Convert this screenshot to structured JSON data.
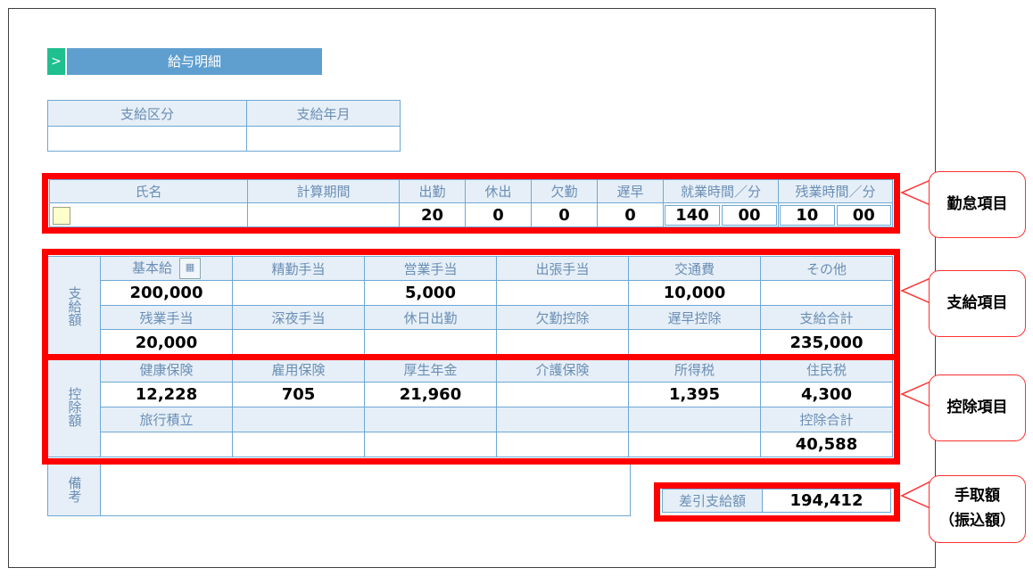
{
  "title": {
    "arrow": ">",
    "label": "給与明細"
  },
  "payment_info": {
    "headers": [
      "支給区分",
      "支給年月"
    ],
    "values": [
      "",
      ""
    ]
  },
  "attendance": {
    "headers": [
      "氏名",
      "計算期間",
      "出勤",
      "休出",
      "欠勤",
      "遅早",
      "就業時間／分",
      "残業時間／分"
    ],
    "values": {
      "name": "",
      "period": "",
      "work_days": "20",
      "holiday_work": "0",
      "absence": "0",
      "late_early": "0",
      "work_hours": "140",
      "work_minutes": "00",
      "overtime_hours": "10",
      "overtime_minutes": "00"
    }
  },
  "payments": {
    "side_label": "支給額",
    "row1_headers": [
      "基本給",
      "精勤手当",
      "営業手当",
      "出張手当",
      "交通費",
      "その他"
    ],
    "row1_values": [
      "200,000",
      "",
      "5,000",
      "",
      "10,000",
      ""
    ],
    "row2_headers": [
      "残業手当",
      "深夜手当",
      "休日出勤",
      "欠勤控除",
      "遅早控除",
      "支給合計"
    ],
    "row2_values": [
      "20,000",
      "",
      "",
      "",
      "",
      "235,000"
    ]
  },
  "deductions": {
    "side_label": "控除額",
    "row1_headers": [
      "健康保険",
      "雇用保険",
      "厚生年金",
      "介護保険",
      "所得税",
      "住民税"
    ],
    "row1_values": [
      "12,228",
      "705",
      "21,960",
      "",
      "1,395",
      "4,300"
    ],
    "row2_headers": [
      "旅行積立",
      "",
      "",
      "",
      "",
      "控除合計"
    ],
    "row2_values": [
      "",
      "",
      "",
      "",
      "",
      "40,588"
    ]
  },
  "remarks": {
    "label": "備考",
    "value": ""
  },
  "net_pay": {
    "label": "差引支給額",
    "value": "194,412"
  },
  "callouts": {
    "attendance": "勤怠項目",
    "payments": "支給項目",
    "deductions": "控除項目",
    "net_pay_line1": "手取額",
    "net_pay_line2": "（振込額）"
  },
  "colors": {
    "highlight": "#ff0000",
    "header_bg": "#e6eff8",
    "border": "#6ea8d4",
    "title_bar": "#5f9fd0",
    "title_arrow": "#1fbf8f"
  }
}
